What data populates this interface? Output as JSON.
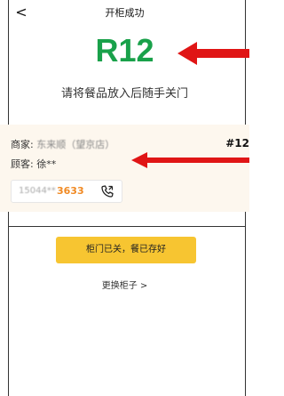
{
  "header": {
    "back_icon": "<",
    "title": "开柜成功"
  },
  "locker": {
    "number": "R12"
  },
  "instruction": "请将餐品放入后随手关门",
  "order_card": {
    "merchant_label": "商家:",
    "merchant_name": "东来顺（望京店）",
    "customer_label": "顾客:",
    "customer_name": "徐**",
    "order_no": "#12",
    "phone_masked": "15044**",
    "phone_suffix": "3633",
    "phone_icon": "phone-call-icon"
  },
  "actions": {
    "confirm_label": "柜门已关，餐已存好",
    "change_locker_label": "更换柜子 >"
  },
  "colors": {
    "locker_green": "#19a14a",
    "arrow_red": "#e01515",
    "button_yellow": "#f7c531",
    "phone_orange": "#f08a24",
    "card_bg": "#fdf7ee"
  }
}
